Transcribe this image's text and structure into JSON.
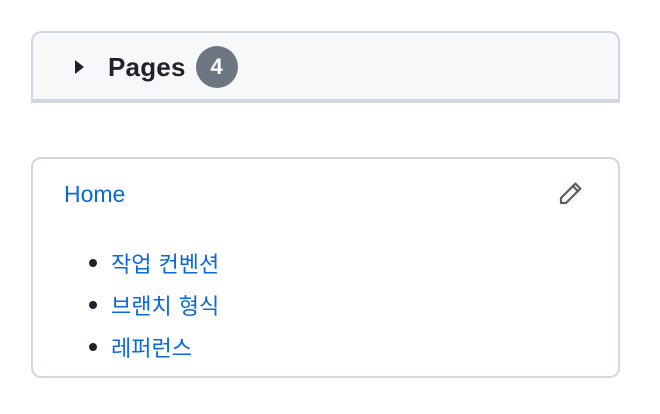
{
  "pages_section": {
    "title": "Pages",
    "count": "4",
    "toggle_icon": "triangle-right-icon"
  },
  "sidebar": {
    "home_label": "Home",
    "edit_icon": "pencil-icon",
    "items": [
      {
        "label": "작업 컨벤션"
      },
      {
        "label": "브랜치 형식"
      },
      {
        "label": "레퍼런스"
      }
    ]
  },
  "colors": {
    "link": "#0969da",
    "badge_bg": "#6e7781",
    "border": "#d0d7de",
    "header_bg": "#f6f8fa"
  }
}
